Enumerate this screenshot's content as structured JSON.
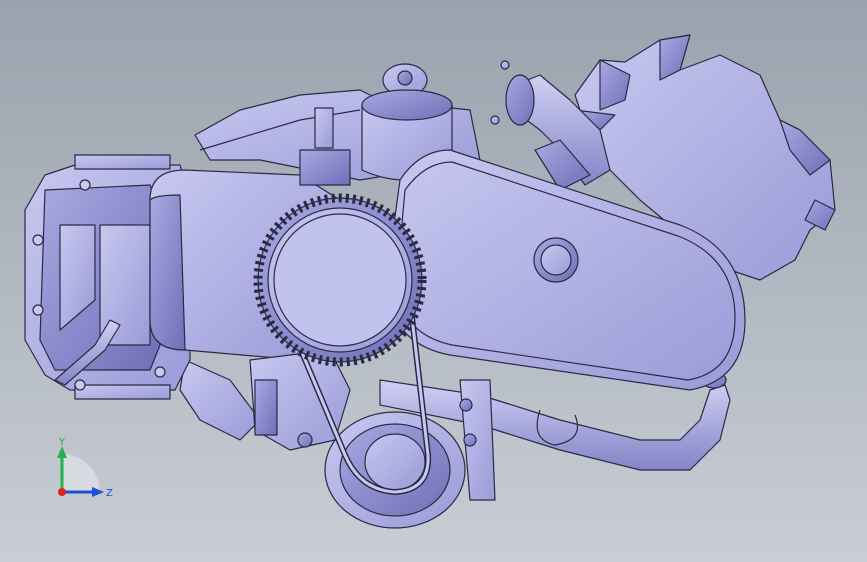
{
  "viewport": {
    "background_top": "#9aa2ad",
    "background_bottom": "#c9ced5"
  },
  "model": {
    "shade_light": "#c8c8f0",
    "shade_mid": "#a9a9e2",
    "shade_dark": "#7c7cc0",
    "edge_color": "#2a2a45"
  },
  "triad": {
    "x_color": "#e0201c",
    "y_color": "#22b14c",
    "z_color": "#1f4fd8",
    "y_label": "Y",
    "z_label": "Z"
  }
}
